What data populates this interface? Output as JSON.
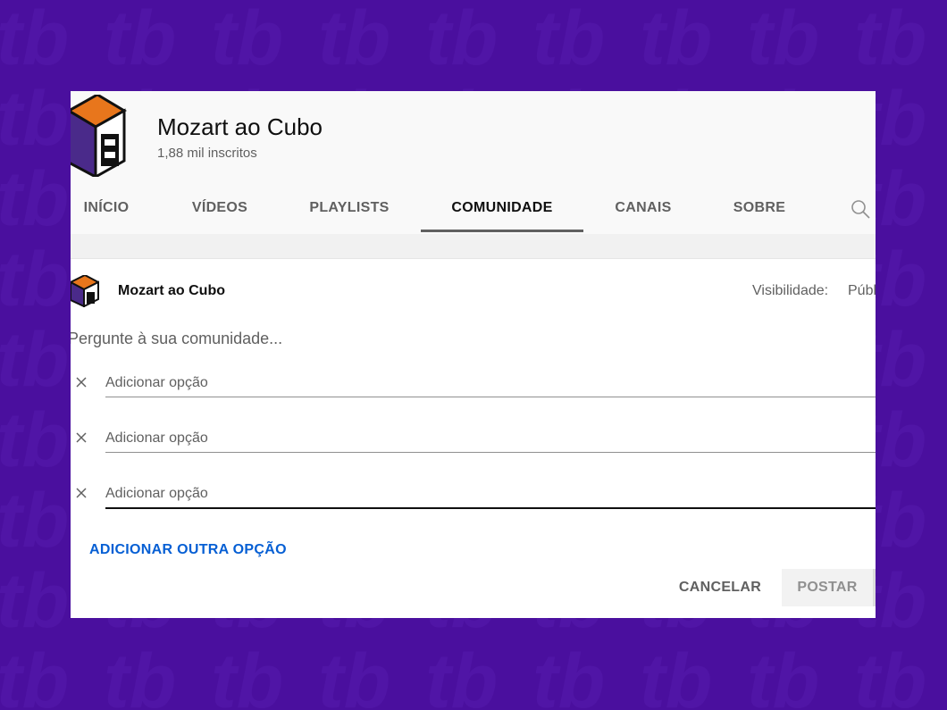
{
  "channel": {
    "name": "Mozart ao Cubo",
    "subscribers": "1,88 mil inscritos"
  },
  "tabs": [
    {
      "label": "INÍCIO",
      "active": false
    },
    {
      "label": "VÍDEOS",
      "active": false
    },
    {
      "label": "PLAYLISTS",
      "active": false
    },
    {
      "label": "COMUNIDADE",
      "active": true
    },
    {
      "label": "CANAIS",
      "active": false
    },
    {
      "label": "SOBRE",
      "active": false
    }
  ],
  "post": {
    "author": "Mozart ao Cubo",
    "visibility_label": "Visibilidade:",
    "visibility_value": "Públ",
    "prompt": "Pergunte à sua comunidade...",
    "options": [
      {
        "placeholder": "Adicionar opção",
        "value": ""
      },
      {
        "placeholder": "Adicionar opção",
        "value": ""
      },
      {
        "placeholder": "Adicionar opção",
        "value": ""
      }
    ],
    "add_option_label": "ADICIONAR OUTRA OPÇÃO",
    "cancel_label": "CANCELAR",
    "post_label": "POSTAR"
  },
  "colors": {
    "background": "#4a0f9e",
    "accent": "#065fd4",
    "logo_orange": "#e8761c",
    "logo_purple": "#4a2a8a"
  }
}
